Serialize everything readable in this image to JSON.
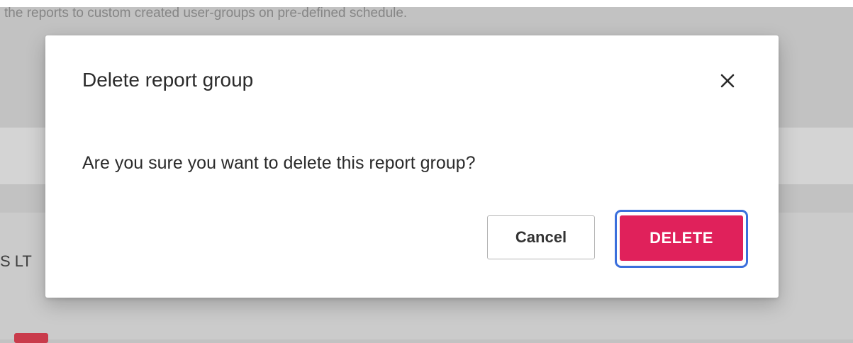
{
  "background": {
    "header_text": "the reports to custom created user-groups on pre-defined schedule.",
    "company_fragment": "S LT"
  },
  "dialog": {
    "title": "Delete report group",
    "message": "Are you sure you want to delete this report group?",
    "close_icon": "close-icon",
    "cancel_label": "Cancel",
    "delete_label": "DELETE"
  },
  "colors": {
    "delete_button": "#e0215b",
    "focus_ring": "#3b6fdc",
    "overlay": "#c2c2c2"
  }
}
